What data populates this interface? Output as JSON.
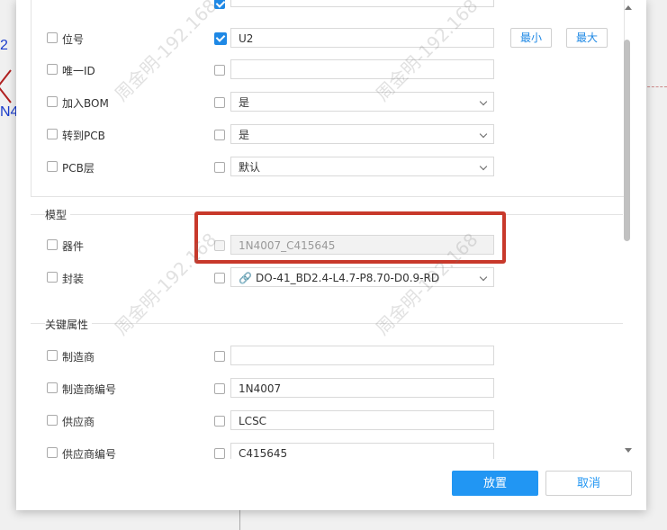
{
  "background": {
    "label_top": "2",
    "label_bottom": "N4"
  },
  "sections": {
    "model_title": "模型",
    "key_attrs_title": "关键属性"
  },
  "rows": {
    "designator": {
      "label": "位号",
      "value": "U2",
      "min_label": "最小",
      "max_label": "最大"
    },
    "unique_id": {
      "label": "唯一ID",
      "value": ""
    },
    "add_bom": {
      "label": "加入BOM",
      "value": "是"
    },
    "to_pcb": {
      "label": "转到PCB",
      "value": "是"
    },
    "pcb_layer": {
      "label": "PCB层",
      "value": "默认"
    },
    "device": {
      "label": "器件",
      "value": "1N4007_C415645"
    },
    "footprint": {
      "label": "封装",
      "value": "DO-41_BD2.4-L4.7-P8.70-D0.9-RD"
    },
    "manufacturer": {
      "label": "制造商",
      "value": ""
    },
    "manufacturer_pn": {
      "label": "制造商编号",
      "value": "1N4007"
    },
    "supplier": {
      "label": "供应商",
      "value": "LCSC"
    },
    "supplier_pn": {
      "label": "供应商编号",
      "value": "C415645"
    }
  },
  "footer": {
    "place_label": "放置",
    "cancel_label": "取消"
  },
  "colors": {
    "accent": "#2196f3",
    "highlight_box": "#c8392b"
  }
}
